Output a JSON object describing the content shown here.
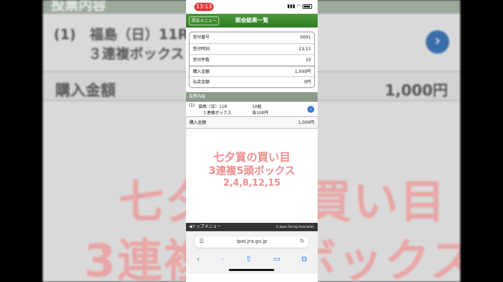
{
  "status_bar": {
    "time": "13:13"
  },
  "header": {
    "menu_button": "照会メニュー",
    "title": "照会結果一覧"
  },
  "info_rows": [
    {
      "label": "受付番号",
      "value": "0001"
    },
    {
      "label": "受付時刻",
      "value": "13:13"
    },
    {
      "label": "受付件数",
      "value": "10"
    },
    {
      "label": "購入金額",
      "value": "1,000円"
    },
    {
      "label": "払戻金額",
      "value": "0円"
    }
  ],
  "bets_section": {
    "title": "投票内容",
    "bet": {
      "number": "(1)",
      "race": "福島（日）11R",
      "type": "３連複ボックス",
      "count": "10組",
      "unit": "各100円"
    },
    "purchase_label": "購入金額",
    "purchase_value": "1,000円"
  },
  "overlay": {
    "line1": "七夕賞の買い目",
    "line2": "3連複5頭ボックス",
    "line3": "2,4,8,12,15"
  },
  "footer": {
    "top_menu": "◀トップメニュー",
    "copyright": "© Japan Racing Association."
  },
  "browser": {
    "url": "ipat.jra.go.jp"
  },
  "background": {
    "header": "投票内容",
    "line1": "(1)　福島（日）11R",
    "line2": "３連複ボックス",
    "row_label": "購入金額",
    "row_value": "1,000円",
    "big1": "七夕賞の買い目",
    "big2": "3連複5頭ボックス"
  },
  "colors": {
    "header_green": "#2d7a23",
    "overlay_text": "#ee8e8e",
    "link_blue": "#2b78e4"
  }
}
